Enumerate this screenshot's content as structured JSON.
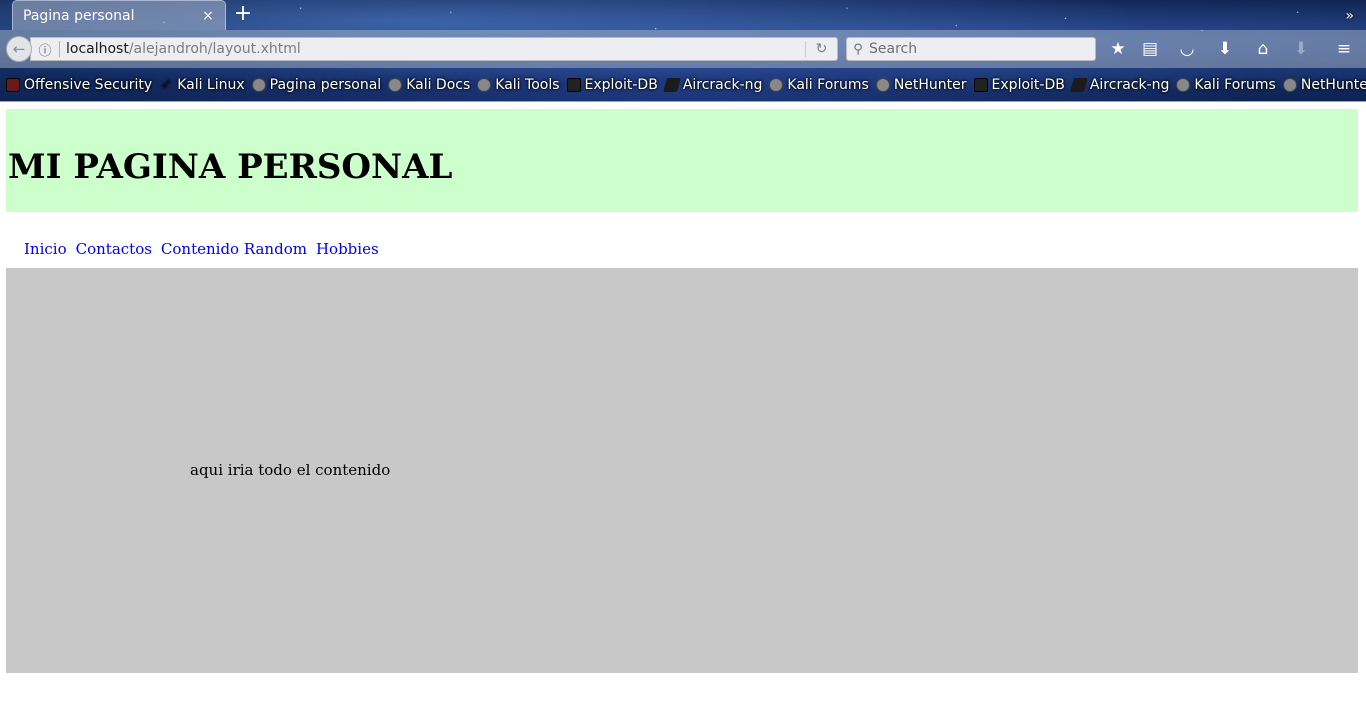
{
  "browser": {
    "tab_title": "Pagina personal",
    "tab_close": "×",
    "new_tab": "+",
    "url_host": "localhost",
    "url_path": "/alejandroh/layout.xhtml",
    "search_placeholder": "Search",
    "bookmarks": [
      {
        "label": "Offensive Security",
        "icon": "offsec-icon"
      },
      {
        "label": "Kali Linux",
        "icon": "kali-dragon-icon"
      },
      {
        "label": "Pagina personal",
        "icon": "globe-icon"
      },
      {
        "label": "Kali Docs",
        "icon": "globe-icon"
      },
      {
        "label": "Kali Tools",
        "icon": "globe-icon"
      },
      {
        "label": "Exploit-DB",
        "icon": "exploit-db-icon"
      },
      {
        "label": "Aircrack-ng",
        "icon": "aircrack-icon"
      },
      {
        "label": "Kali Forums",
        "icon": "globe-icon"
      },
      {
        "label": "NetHunter",
        "icon": "globe-icon"
      },
      {
        "label": "Exploit-DB",
        "icon": "exploit-db-icon"
      },
      {
        "label": "Aircrack-ng",
        "icon": "aircrack-icon"
      },
      {
        "label": "Kali Forums",
        "icon": "globe-icon"
      },
      {
        "label": "NetHunter",
        "icon": "globe-icon"
      }
    ],
    "bookmarks_more": "»"
  },
  "page": {
    "title": "MI PAGINA PERSONAL",
    "menu": [
      "Inicio",
      "Contactos",
      "Contenido Random",
      "Hobbies"
    ],
    "content_text": "aqui iria todo el contenido"
  },
  "colors": {
    "header_bg": "#ccffcc",
    "content_bg": "#c8c8c8",
    "link": "#0000ee"
  }
}
